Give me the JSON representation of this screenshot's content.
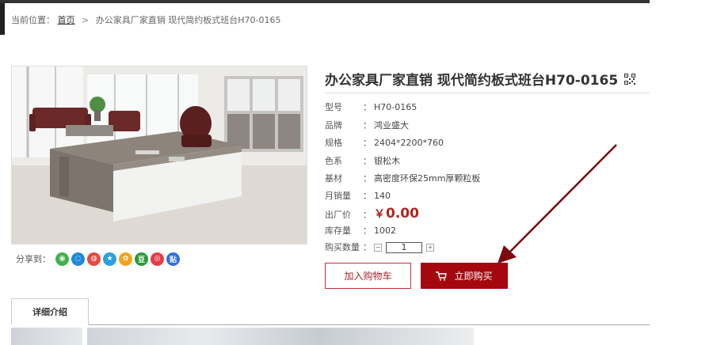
{
  "breadcrumb": {
    "label": "当前位置：",
    "home": "首页",
    "separator": ">",
    "current": "办公家具厂家直销 现代简约板式班台H70-0165"
  },
  "product": {
    "title": "办公家具厂家直销 现代简约板式班台H70-0165",
    "qr_icon": "qr-code-icon",
    "specs": [
      {
        "label": "型号",
        "value": "H70-0165"
      },
      {
        "label": "品牌",
        "value": "鸿业盛大"
      },
      {
        "label": "规格",
        "value": "2404*2200*760"
      },
      {
        "label": "色系",
        "value": "银松木"
      },
      {
        "label": "基材",
        "value": "高密度环保25mm厚颗粒板"
      },
      {
        "label": "月销量",
        "value": "140"
      }
    ],
    "price": {
      "label": "出厂价",
      "currency": "￥",
      "value": "0.00"
    },
    "stock": {
      "label": "库存量",
      "value": "1002"
    },
    "quantity": {
      "label": "购买数量",
      "value": "1",
      "minus": "−",
      "plus": "+"
    },
    "colon": "："
  },
  "share": {
    "label": "分享到：",
    "icons": [
      {
        "name": "wechat-icon",
        "color": "#3fb24a",
        "glyph": "◉"
      },
      {
        "name": "qzone-icon",
        "color": "#1f8ad9",
        "glyph": "◌"
      },
      {
        "name": "weibo-icon",
        "color": "#e8493e",
        "glyph": "◍"
      },
      {
        "name": "qq-space-icon",
        "color": "#2aa0e0",
        "glyph": "★"
      },
      {
        "name": "pengyou-icon",
        "color": "#f6a21a",
        "glyph": "✿"
      },
      {
        "name": "douban-icon",
        "color": "#2c9a3c",
        "glyph": "豆"
      },
      {
        "name": "renren-icon",
        "color": "#e63c44",
        "glyph": "◎"
      },
      {
        "name": "tieba-icon",
        "color": "#2f6fe0",
        "glyph": "贴"
      }
    ]
  },
  "actions": {
    "add_to_cart": "加入购物车",
    "buy_now": "立即购买",
    "cart_icon": "shopping-cart-icon"
  },
  "tabs": {
    "detail": "详细介绍"
  },
  "colors": {
    "accent": "#a5070f",
    "price": "#b0251d",
    "arrow": "#7a0a0e"
  }
}
